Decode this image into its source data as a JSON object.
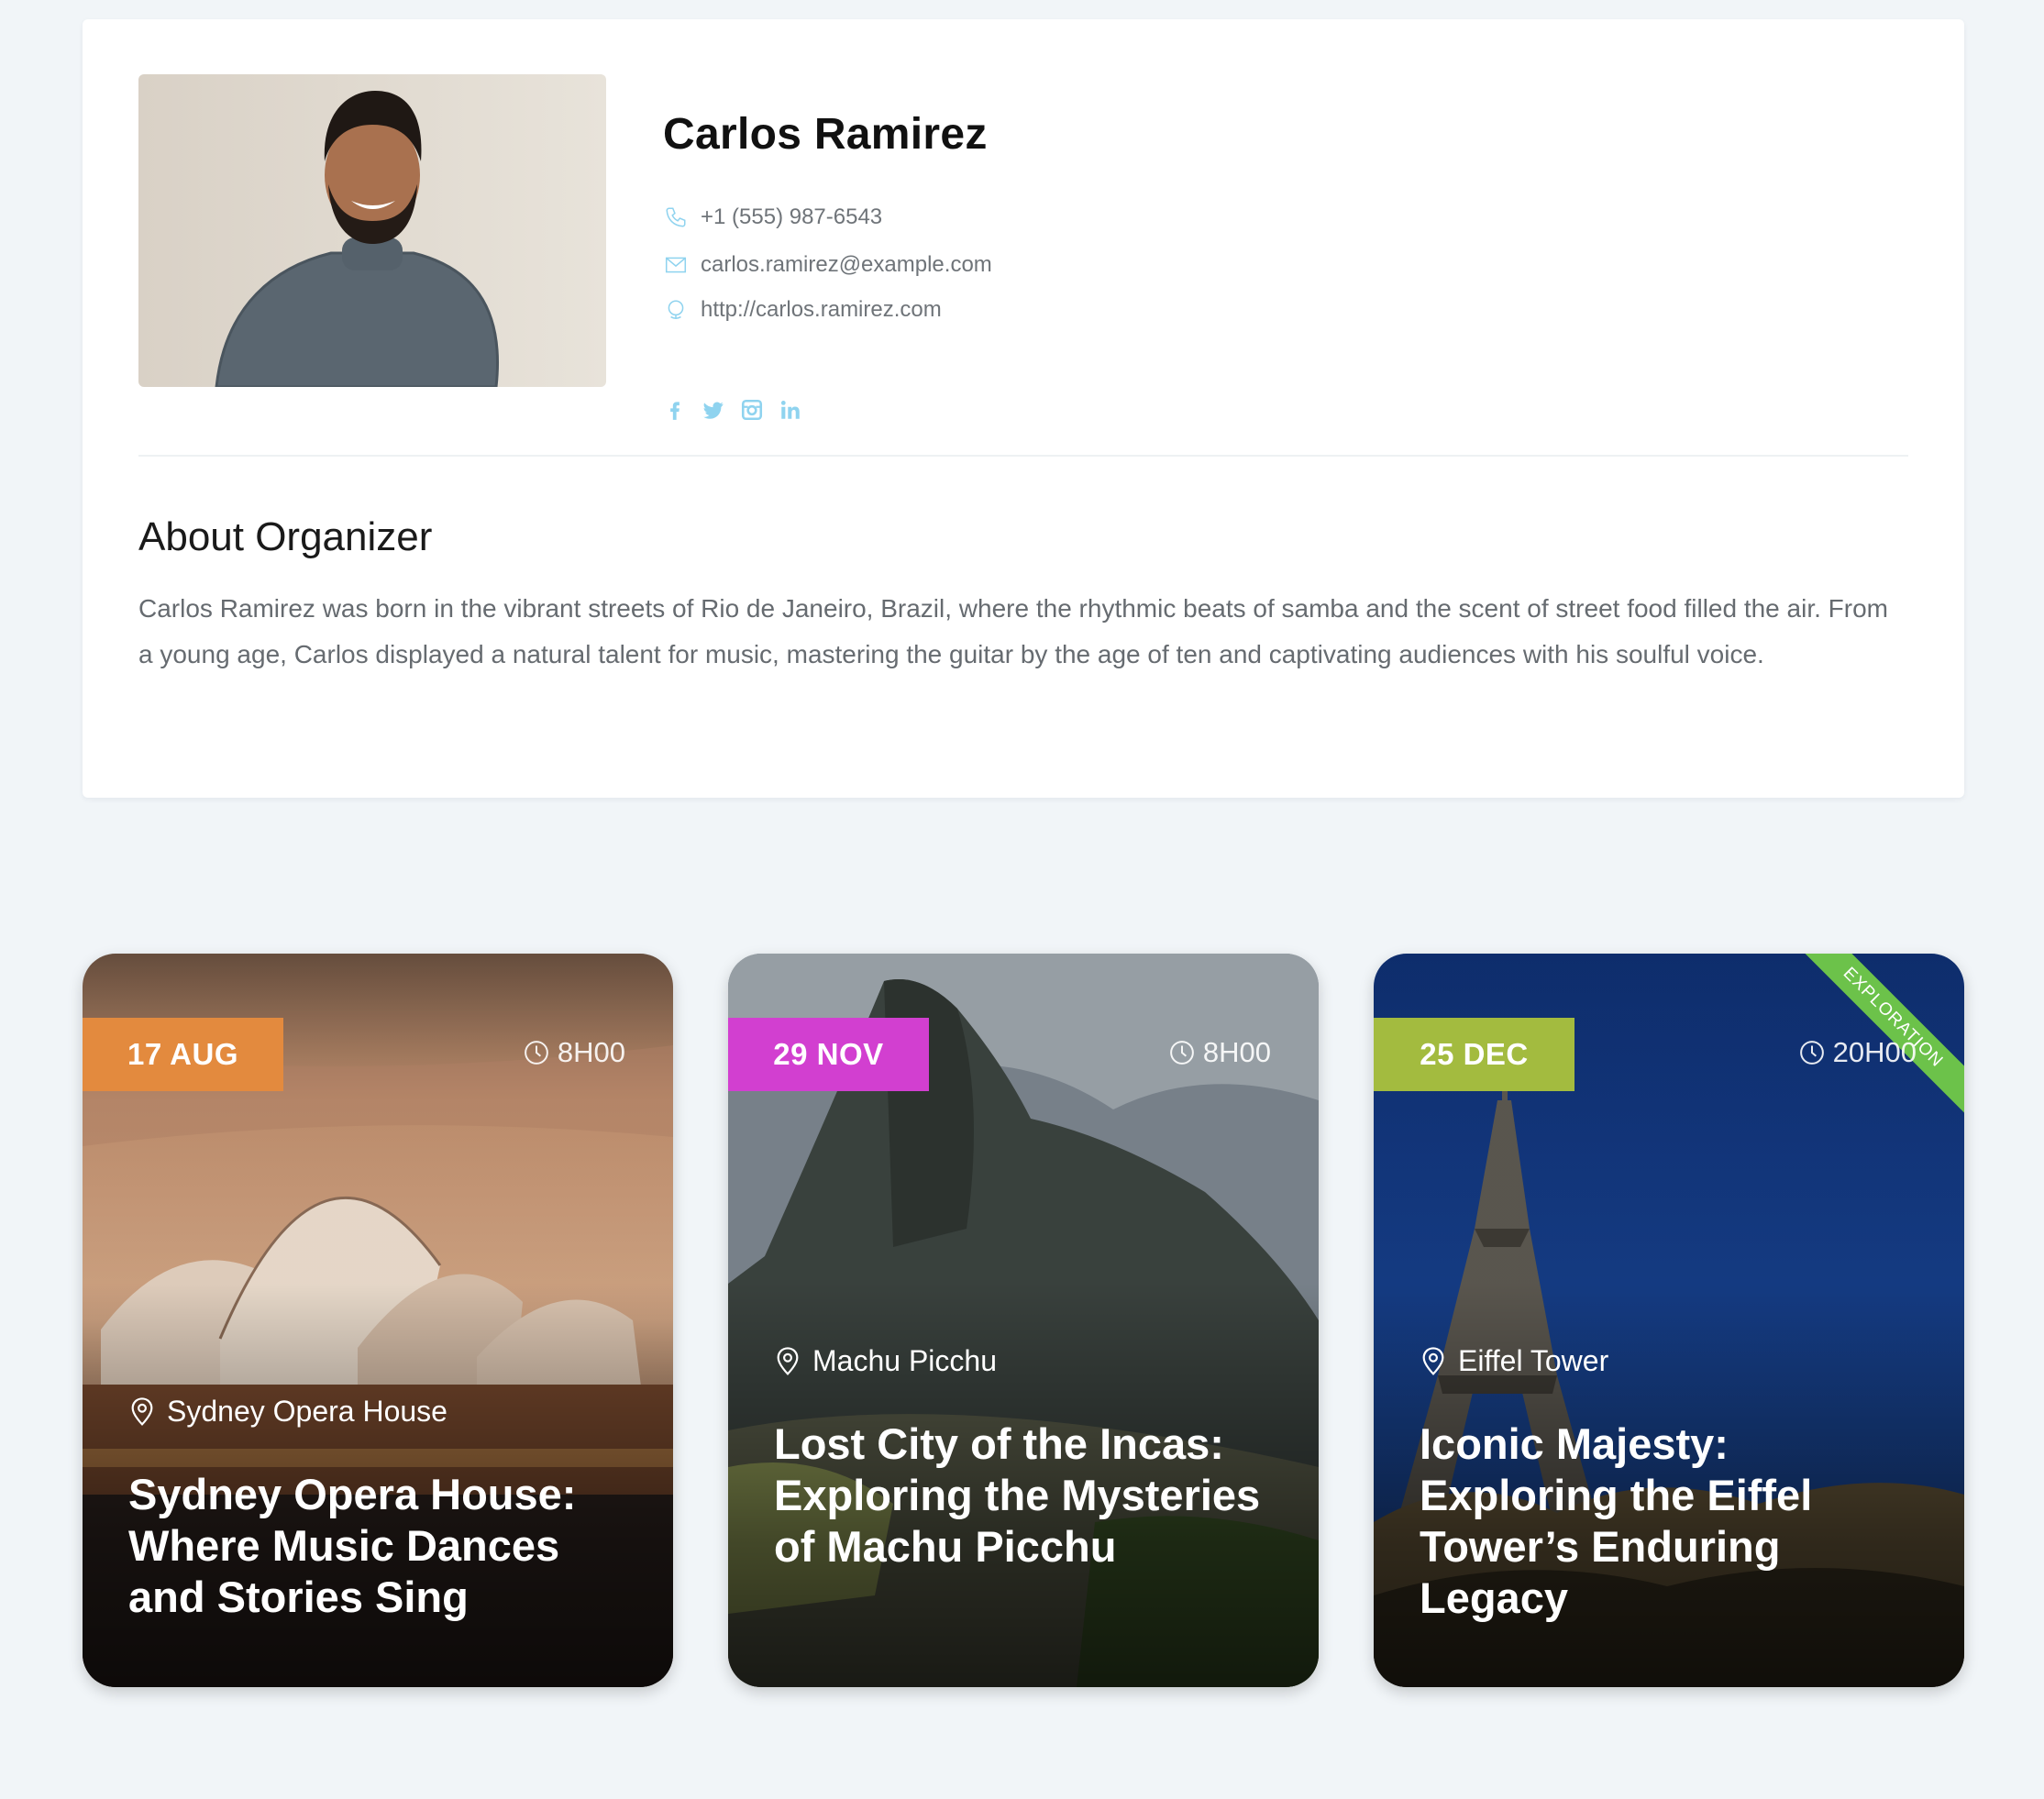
{
  "organizer": {
    "name": "Carlos Ramirez",
    "phone": "+1 (555) 987-6543",
    "email": "carlos.ramirez@example.com",
    "website": "http://carlos.ramirez.com",
    "social": [
      "facebook-icon",
      "twitter-icon",
      "instagram-icon",
      "linkedin-icon"
    ],
    "accent_color": "#8fd3ef"
  },
  "about": {
    "title": "About Organizer",
    "text": "Carlos Ramirez was born in the vibrant streets of Rio de Janeiro, Brazil, where the rhythmic beats of samba and the scent of street food filled the air. From a young age, Carlos displayed a natural talent for music, mastering the guitar by the age of ten and captivating audiences with his soulful voice."
  },
  "events": [
    {
      "date": "17 AUG",
      "time": "8H00",
      "location": "Sydney Opera House",
      "title": "Sydney Opera House: Where Music Dances and Stories Sing",
      "badge_color": "#e38a3e"
    },
    {
      "date": "29 NOV",
      "time": "8H00",
      "location": "Machu Picchu",
      "title": "Lost City of the Incas: Exploring the Mysteries of Machu Picchu",
      "badge_color": "#d23fd0"
    },
    {
      "date": "25 DEC",
      "time": "20H00",
      "location": "Eiffel Tower",
      "title": "Iconic Majesty: Exploring the Eiffel Tower’s Enduring Legacy",
      "badge_color": "#a3bb3f",
      "ribbon": "EXPLORATION",
      "ribbon_color": "#6cc24a"
    }
  ]
}
